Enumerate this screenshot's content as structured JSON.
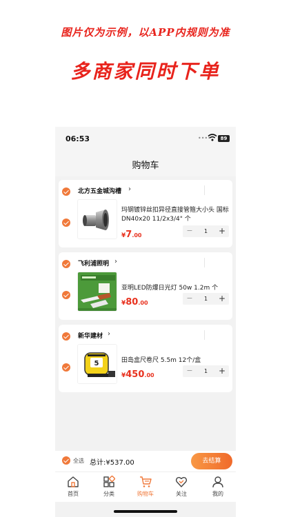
{
  "promo": {
    "note": "图片仅为示例，以APP内规则为准",
    "headline": "多商家同时下单"
  },
  "status_bar": {
    "time": "06:53",
    "battery": "89"
  },
  "nav": {
    "title": "购物车"
  },
  "shops": [
    {
      "name": "北方五金城沟槽",
      "item": {
        "name": "玛钢镀锌丝扣异径直接管箍大小头 国标DN40x20 11/2x3/4\" 个",
        "price_symbol": "¥",
        "price_int": "7",
        "price_dec": ".00",
        "qty": "1"
      }
    },
    {
      "name": "飞利浦照明",
      "item": {
        "name": "亚明LED防爆日光灯 50w 1.2m 个",
        "price_symbol": "¥",
        "price_int": "80",
        "price_dec": ".00",
        "qty": "1"
      }
    },
    {
      "name": "新华建材",
      "item": {
        "name": "田岛盒尺卷尺 5.5m 12个/盒",
        "price_symbol": "¥",
        "price_int": "450",
        "price_dec": ".00",
        "qty": "1"
      }
    }
  ],
  "stepper": {
    "minus": "−",
    "plus": "+"
  },
  "checkout": {
    "select_all": "全选",
    "total": "总计:¥537.00",
    "button": "去结算"
  },
  "tabs": [
    {
      "label": "首页",
      "icon": "home-icon"
    },
    {
      "label": "分类",
      "icon": "category-icon"
    },
    {
      "label": "购物车",
      "icon": "cart-icon"
    },
    {
      "label": "关注",
      "icon": "heart-icon"
    },
    {
      "label": "我的",
      "icon": "user-icon"
    }
  ],
  "colors": {
    "accent": "#f0793a",
    "price": "#e8321f",
    "promo": "#e8231c"
  }
}
